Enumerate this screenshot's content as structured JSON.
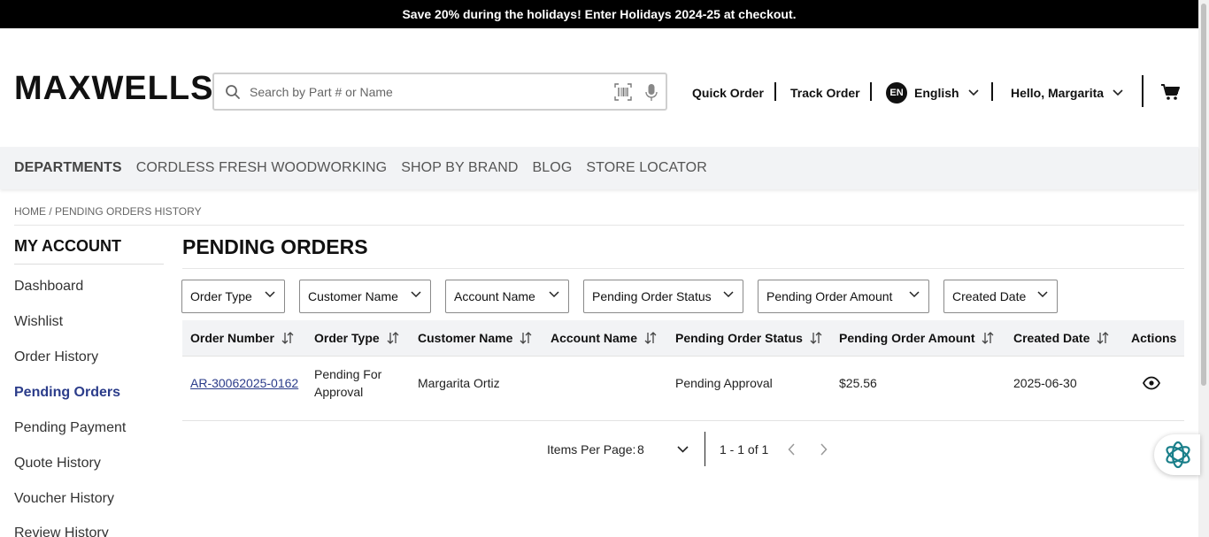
{
  "promo": {
    "text": "Save 20% during the holidays! Enter Holidays 2024-25 at checkout."
  },
  "header": {
    "logo": "MAXWELLS",
    "search_placeholder": "Search by Part # or Name",
    "quick_order": "Quick Order",
    "track_order": "Track Order",
    "lang_code": "EN",
    "language": "English",
    "greeting": "Hello, Margarita"
  },
  "categories": [
    "DEPARTMENTS",
    "CORDLESS FRESH WOODWORKING",
    "SHOP BY BRAND",
    "BLOG",
    "STORE LOCATOR"
  ],
  "breadcrumb": "HOME / PENDING ORDERS HISTORY",
  "sidebar": {
    "title": "MY ACCOUNT",
    "items": [
      {
        "label": "Dashboard",
        "active": false
      },
      {
        "label": "Wishlist",
        "active": false
      },
      {
        "label": "Order History",
        "active": false
      },
      {
        "label": "Pending Orders",
        "active": true
      },
      {
        "label": "Pending Payment",
        "active": false
      },
      {
        "label": "Quote History",
        "active": false
      },
      {
        "label": "Voucher History",
        "active": false
      },
      {
        "label": "Review History",
        "active": false
      }
    ]
  },
  "main": {
    "title": "PENDING ORDERS",
    "filters": [
      "Order Type",
      "Customer Name",
      "Account Name",
      "Pending Order Status",
      "Pending Order Amount",
      "Created Date"
    ],
    "columns": [
      "Order Number",
      "Order Type",
      "Customer Name",
      "Account Name",
      "Pending Order Status",
      "Pending Order Amount",
      "Created Date",
      "Actions"
    ],
    "rows": [
      {
        "order_number": "AR-30062025-0162",
        "order_type_line1": "Pending For",
        "order_type_line2": "Approval",
        "customer_name": "Margarita Ortiz",
        "account_name": "",
        "status": "Pending Approval",
        "amount": "$25.56",
        "created_date": "2025-06-30"
      }
    ],
    "pagination": {
      "items_per_page_label": "Items Per Page:",
      "items_per_page_value": "8",
      "range": "1 - 1 of 1"
    }
  },
  "colors": {
    "accent": "#2b3c8a",
    "promo_bg": "#000000",
    "ai_icon": "#1a7f8a"
  }
}
